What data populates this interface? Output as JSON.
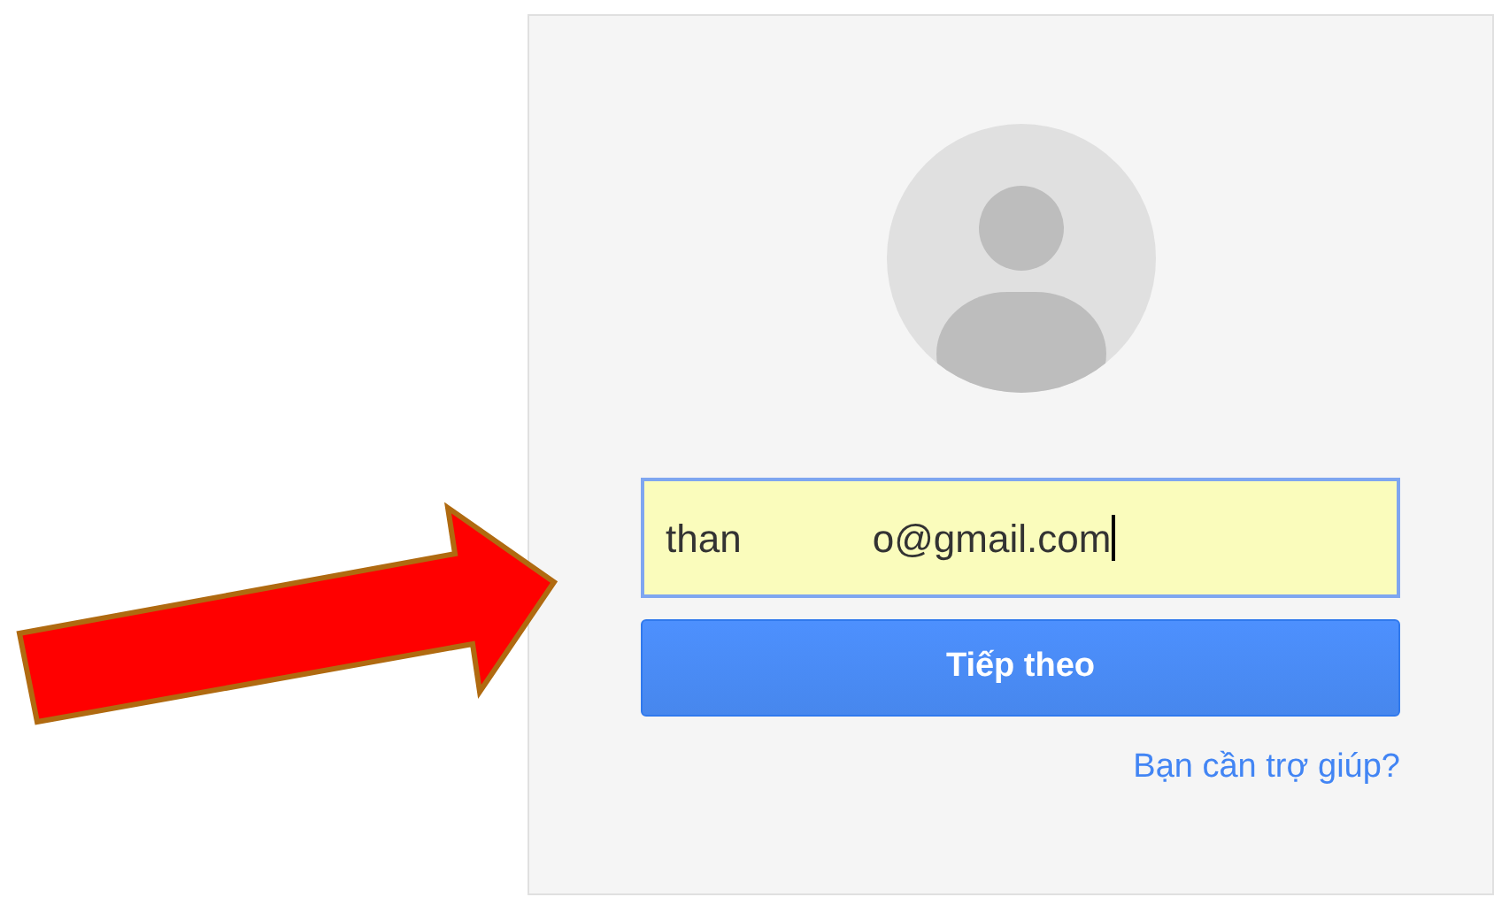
{
  "account_field": {
    "value_parts": [
      "than",
      "o@gmail.com"
    ],
    "focused": true
  },
  "next_button": {
    "label": "Tiếp theo"
  },
  "help_link": {
    "label": "Bạn cần trợ giúp?"
  }
}
